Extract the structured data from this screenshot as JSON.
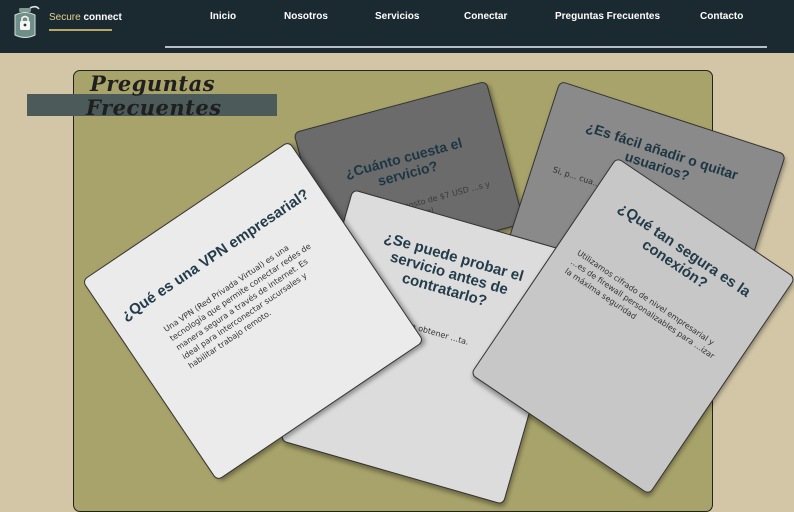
{
  "brand": {
    "name_accent": "Secure",
    "name_main": "connect",
    "icon": "lock-jar-icon"
  },
  "nav": [
    {
      "label": "Inicio"
    },
    {
      "label": "Nosotros"
    },
    {
      "label": "Servicios"
    },
    {
      "label": "Conectar"
    },
    {
      "label": "Preguntas Frecuentes"
    },
    {
      "label": "Contacto"
    }
  ],
  "page": {
    "title_line1": "Preguntas",
    "title_line2": "Frecuentes"
  },
  "faq": [
    {
      "question": "¿Cuánto cuesta el servicio?",
      "answer": "...icio tiene un costo de $7 USD ...s y $20 USD por sucursal"
    },
    {
      "question": "¿Es fácil añadir o quitar usuarios?",
      "answer": "Si, p... cua... de..."
    },
    {
      "question": "¿Qué es una VPN empresarial?",
      "answer": "Una VPN (Red Privada Virtual) es una tecnología que permite conectar redes de manera segura a través de internet. Es ideal para interconectar sucursales y habilitar trabajo remoto."
    },
    {
      "question": "¿Se puede probar el servicio antes de contratarlo?",
      "answer": "...ntáctanos para obtener ...ta."
    },
    {
      "question": "¿Qué tan segura es la conexión?",
      "answer": "Utilizamos cifrado de nivel empresarial y ...es de firewall personalizables para ...izar la máxima seguridad"
    }
  ],
  "colors": {
    "header": "#1b2a31",
    "background": "#d3c6a6",
    "board": "#a8a36a",
    "accent": "#e3cf8c"
  }
}
